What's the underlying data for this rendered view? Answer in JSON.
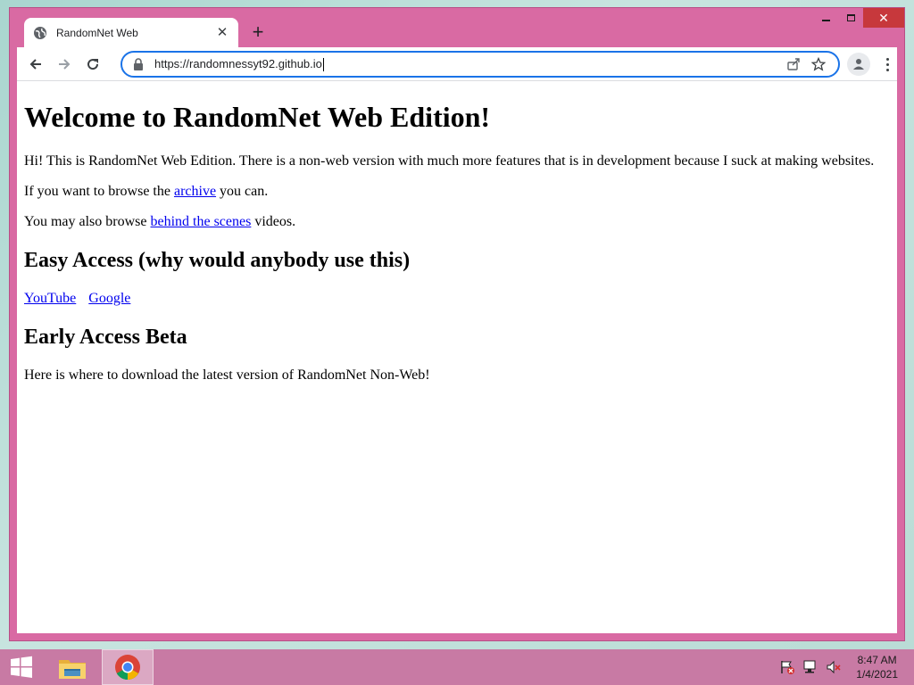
{
  "browser": {
    "tab_title": "RandomNet Web",
    "url": "https://randomnessyt92.github.io",
    "new_tab_symbol": "+",
    "close_symbol": "✕",
    "icons": [
      "globe-icon",
      "close-icon",
      "new-tab-icon",
      "back-icon",
      "forward-icon",
      "reload-icon",
      "lock-icon",
      "share-icon",
      "star-icon",
      "profile-icon",
      "menu-icon",
      "minimize-icon",
      "maximize-icon"
    ]
  },
  "page": {
    "heading": "Welcome to RandomNet Web Edition!",
    "intro": "Hi! This is RandomNet Web Edition. There is a non-web version with much more features that is in development because I suck at making websites.",
    "archive_pre": "If you want to browse the ",
    "archive_link": "archive",
    "archive_post": " you can.",
    "bts_pre": "You may also browse ",
    "bts_link": "behind the scenes",
    "bts_post": " videos.",
    "easy_access_heading": "Easy Access (why would anybody use this)",
    "easy_access_links": [
      "YouTube",
      "Google"
    ],
    "beta_heading": "Early Access Beta",
    "beta_text": "Here is where to download the latest version of RandomNet Non-Web!"
  },
  "taskbar": {
    "time": "8:47 AM",
    "date": "1/4/2021",
    "icons": [
      "windows-start-icon",
      "file-explorer-icon",
      "chrome-icon",
      "action-center-icon",
      "network-icon",
      "volume-muted-icon"
    ]
  },
  "colors": {
    "window_frame": "#d96aa3",
    "taskbar": "#c87aa4",
    "link": "#0000ee",
    "omnibox_focus": "#1a73e8",
    "close_button": "#c7383c"
  }
}
